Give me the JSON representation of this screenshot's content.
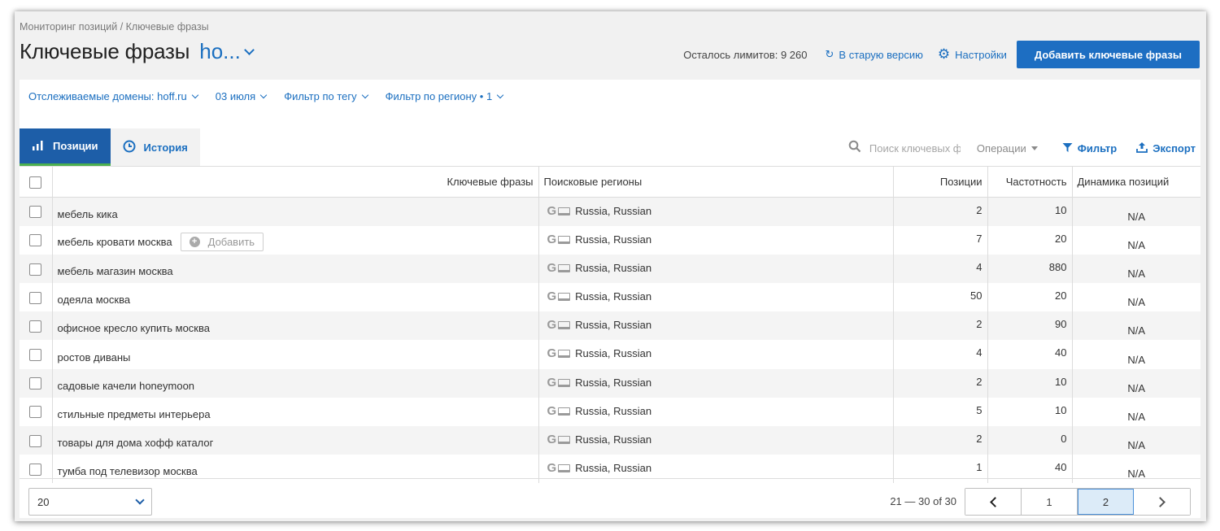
{
  "breadcrumb": "Мониторинг позиций / Ключевые фразы",
  "page_title": "Ключевые фразы",
  "domain_switch": "ho...",
  "header": {
    "limits": "Осталось лимитов: 9 260",
    "old_version": "В старую версию",
    "settings": "Настройки",
    "add_button": "Добавить ключевые фразы"
  },
  "filters": {
    "domains": "Отслеживаемые домены: hoff.ru",
    "date": "03 июля",
    "tag": "Фильтр по тегу",
    "region": "Фильтр по региону • 1"
  },
  "tabs": [
    {
      "label": "Позиции",
      "icon": "bar-chart-icon"
    },
    {
      "label": "История",
      "icon": "clock-icon"
    }
  ],
  "toolbar": {
    "search_placeholder": "Поиск ключевых фраз",
    "operations": "Операции",
    "filter": "Фильтр",
    "export": "Экспорт"
  },
  "table": {
    "headers": {
      "keyword": "Ключевые фразы",
      "regions": "Поисковые регионы",
      "positions": "Позиции",
      "frequency": "Частотность",
      "dynamics": "Динамика позиций"
    },
    "add_tag_label": "Добавить",
    "rows": [
      {
        "keyword": "мебель кика",
        "region": "Russia, Russian",
        "position": "2",
        "frequency": "10",
        "dynamics": "N/A"
      },
      {
        "keyword": "мебель кровати москва",
        "region": "Russia, Russian",
        "position": "7",
        "frequency": "20",
        "dynamics": "N/A"
      },
      {
        "keyword": "мебель магазин москва",
        "region": "Russia, Russian",
        "position": "4",
        "frequency": "880",
        "dynamics": "N/A"
      },
      {
        "keyword": "одеяла москва",
        "region": "Russia, Russian",
        "position": "50",
        "frequency": "20",
        "dynamics": "N/A"
      },
      {
        "keyword": "офисное кресло купить москва",
        "region": "Russia, Russian",
        "position": "2",
        "frequency": "90",
        "dynamics": "N/A"
      },
      {
        "keyword": "ростов диваны",
        "region": "Russia, Russian",
        "position": "4",
        "frequency": "40",
        "dynamics": "N/A"
      },
      {
        "keyword": "садовые качели honeymoon",
        "region": "Russia, Russian",
        "position": "2",
        "frequency": "10",
        "dynamics": "N/A"
      },
      {
        "keyword": "стильные предметы интерьера",
        "region": "Russia, Russian",
        "position": "5",
        "frequency": "10",
        "dynamics": "N/A"
      },
      {
        "keyword": "товары для дома хофф каталог",
        "region": "Russia, Russian",
        "position": "2",
        "frequency": "0",
        "dynamics": "N/A"
      },
      {
        "keyword": "тумба под телевизор москва",
        "region": "Russia, Russian",
        "position": "1",
        "frequency": "40",
        "dynamics": "N/A"
      }
    ]
  },
  "footer": {
    "page_size": "20",
    "range": "21 — 30 of 30",
    "pages": [
      "1",
      "2"
    ],
    "current_page": "2"
  },
  "colors": {
    "accent": "#1b6fc0",
    "button": "#1d6ec2",
    "active_tab": "#1d5ea8",
    "tab_underline": "#4caf50"
  }
}
